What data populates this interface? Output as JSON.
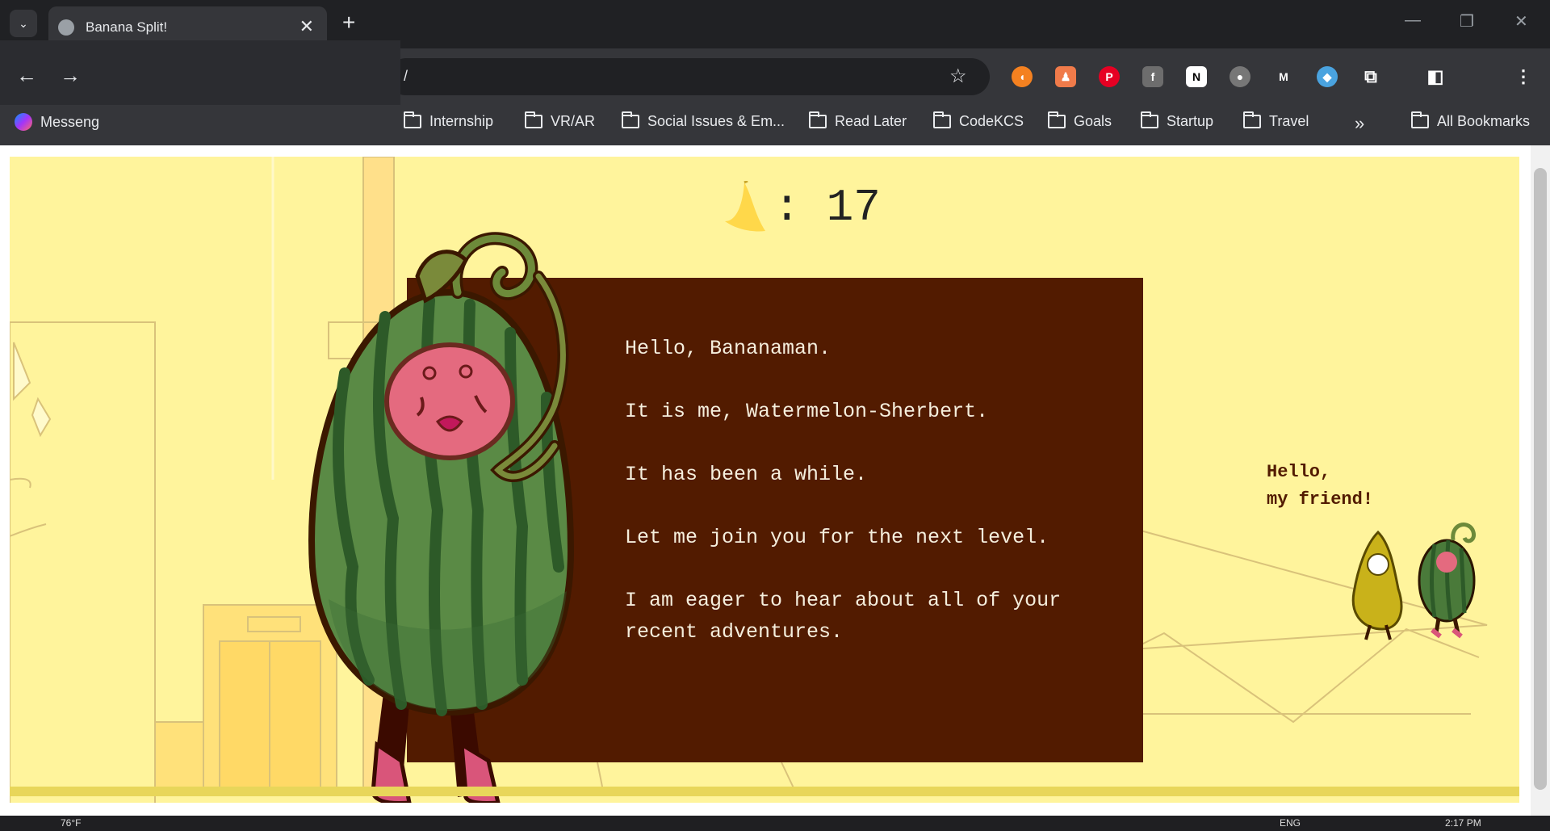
{
  "browser": {
    "tab_title": "Banana Split!",
    "address": "/",
    "bookmarks": [
      "Messeng",
      "Internship",
      "VR/AR",
      "Social Issues & Em...",
      "Read Later",
      "CodeKCS",
      "Goals",
      "Startup",
      "Travel"
    ],
    "all_bookmarks_label": "All Bookmarks",
    "more_bookmarks_label": "»"
  },
  "game": {
    "banana_count": "17",
    "counter_separator": ":",
    "dialog_lines": [
      "Hello, Bananaman.",
      "It is me, Watermelon-Sherbert.",
      "It has been a while.",
      "Let me join you for the next level.",
      "I am eager to hear about all of your recent adventures."
    ],
    "friend_bubble_line1": "Hello,",
    "friend_bubble_line2": "my friend!"
  },
  "taskbar": {
    "weather": "76°F",
    "language": "ENG",
    "time": "2:17 PM"
  },
  "colors": {
    "game_background": "#fff49c",
    "dialog_background": "#521b00",
    "dialog_text": "#f5eedc",
    "bubble_text": "#521b00"
  }
}
